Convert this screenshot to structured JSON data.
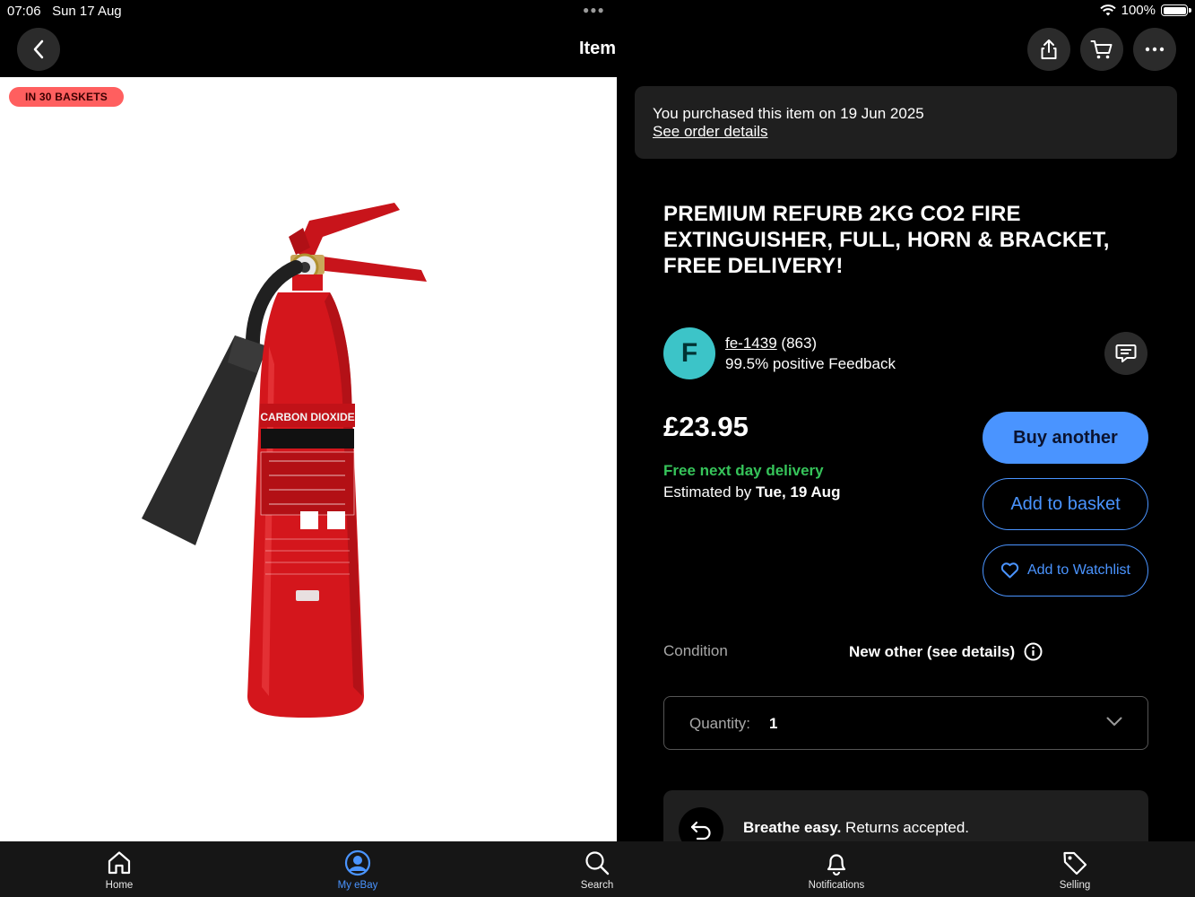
{
  "status_bar": {
    "time": "07:06",
    "date": "Sun 17 Aug",
    "battery": "100%"
  },
  "nav": {
    "title": "Item"
  },
  "image": {
    "badge": "IN 30 BASKETS",
    "label_text": "CARBON DIOXIDE"
  },
  "purchase": {
    "text": "You purchased this item on 19 Jun 2025",
    "link": "See order details"
  },
  "item": {
    "title": "PREMIUM REFURB 2KG CO2 FIRE EXTINGUISHER, FULL, HORN & BRACKET, FREE DELIVERY!"
  },
  "seller": {
    "initial": "F",
    "name": "fe-1439",
    "score": "(863)",
    "feedback": "99.5% positive Feedback"
  },
  "price": "£23.95",
  "delivery": {
    "headline": "Free next day delivery",
    "estimate_prefix": "Estimated by",
    "estimate_date": "Tue, 19 Aug"
  },
  "actions": {
    "buy_again": "Buy another",
    "add_basket": "Add to basket",
    "watchlist": "Add to Watchlist"
  },
  "condition": {
    "label": "Condition",
    "value": "New other (see details)"
  },
  "quantity": {
    "label": "Quantity:",
    "value": "1"
  },
  "returns": {
    "bold": "Breathe easy.",
    "rest": "Returns accepted."
  },
  "tabs": [
    {
      "label": "Home",
      "icon": "home-icon"
    },
    {
      "label": "My eBay",
      "icon": "account-icon",
      "active": true
    },
    {
      "label": "Search",
      "icon": "search-icon"
    },
    {
      "label": "Notifications",
      "icon": "bell-icon"
    },
    {
      "label": "Selling",
      "icon": "tag-icon"
    }
  ],
  "colors": {
    "accent": "#4a94ff",
    "success": "#36c45a",
    "badge": "#ff5f5f",
    "avatar": "#3cc4c8",
    "extinguisher": "#d4161c"
  }
}
